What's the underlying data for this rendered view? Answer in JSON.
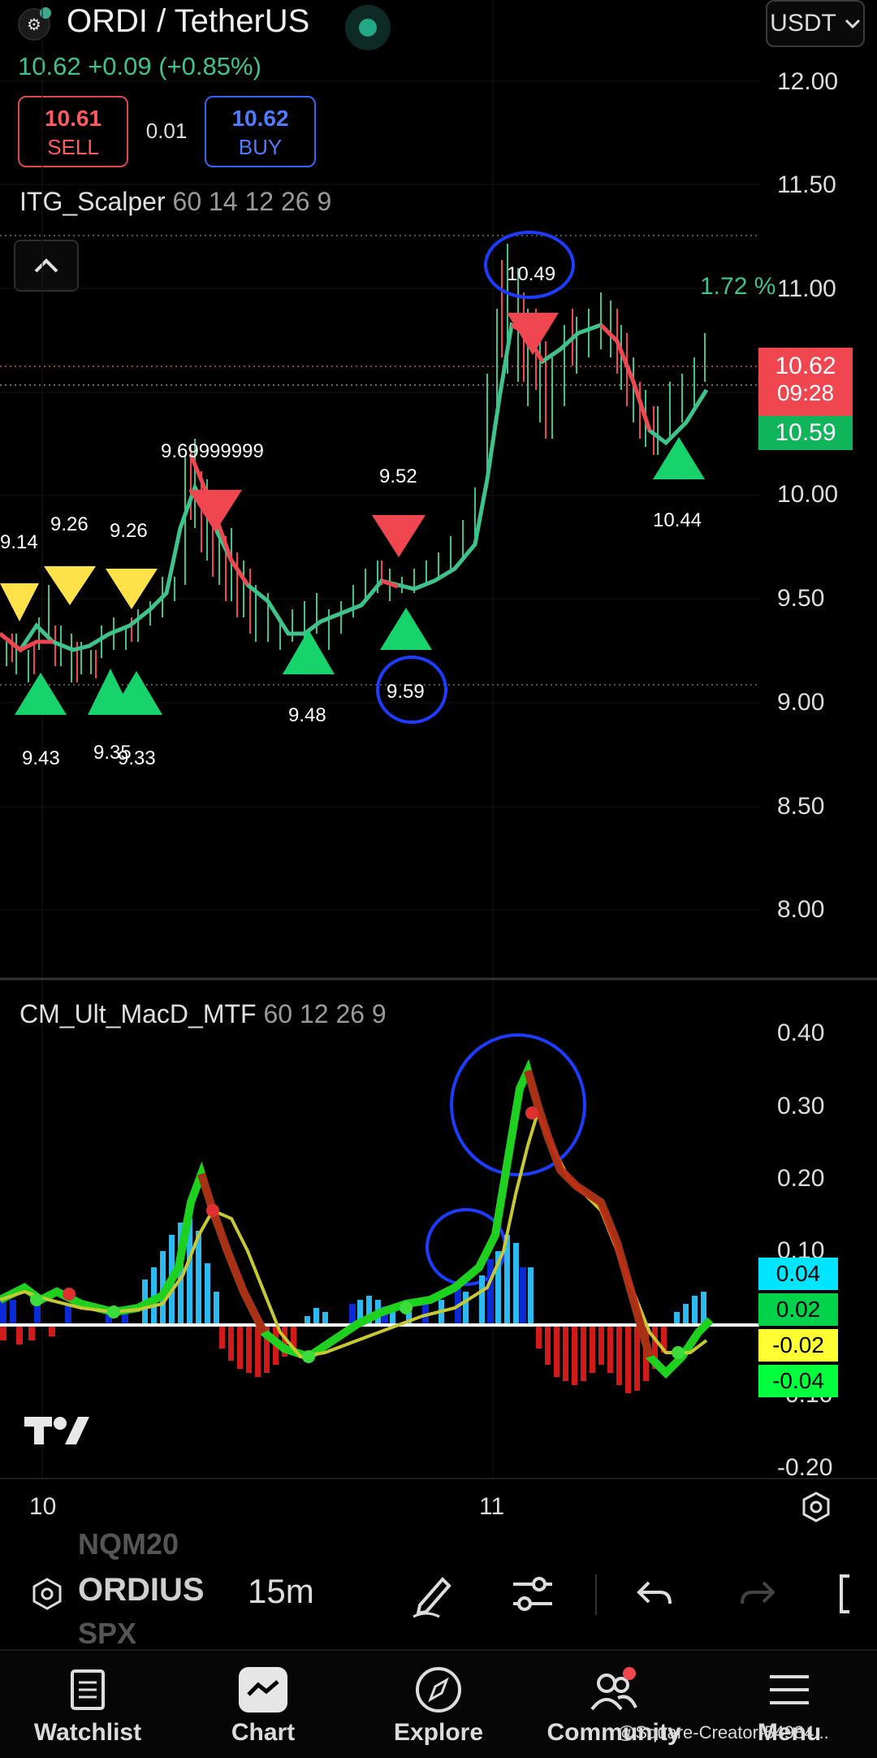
{
  "header": {
    "symbol_title": "ORDI / TetherUS",
    "quote_currency": "USDT",
    "last_change": "10.62  +0.09 (+0.85%)",
    "sell_price": "10.61",
    "sell_label": "SELL",
    "spread": "0.01",
    "buy_price": "10.62",
    "buy_label": "BUY"
  },
  "indicators": {
    "main_name": "ITG_Scalper",
    "main_params": "60 14 12 26 9",
    "macd_name": "CM_Ult_MacD_MTF",
    "macd_params": "60 12 26 9"
  },
  "price_axis": {
    "ticks": [
      "12.00",
      "11.50",
      "11.00",
      "10.50",
      "10.00",
      "9.50",
      "9.00",
      "8.50",
      "8.00"
    ],
    "current_price": "10.62",
    "countdown": "09:28",
    "green_price": "10.59"
  },
  "macd_axis": {
    "ticks": [
      "0.40",
      "0.30",
      "0.20",
      "0.10",
      "-0.10",
      "-0.20"
    ],
    "tags": [
      {
        "value": "0.04",
        "color": "#00e5ff"
      },
      {
        "value": "0.02",
        "color": "#00d24a"
      },
      {
        "value": "-0.02",
        "color": "#ffff33"
      },
      {
        "value": "-0.04",
        "color": "#00ff3c"
      }
    ]
  },
  "time_axis": {
    "ticks": [
      "10",
      "11"
    ]
  },
  "annotations": {
    "percent": "1.72 %",
    "labels": [
      "9.14",
      "9.26",
      "9.26",
      "9.69999999",
      "9.52",
      "10.49",
      "10.44",
      "9.43",
      "9.35",
      "9.33",
      "9.48",
      "9.59"
    ]
  },
  "toolbar": {
    "symbol": "ORDIUS",
    "ghost_top": "NQM20",
    "ghost_bottom": "SPX",
    "timeframe": "15m"
  },
  "nav": {
    "items": [
      "Watchlist",
      "Chart",
      "Explore",
      "Community",
      "Menu"
    ]
  },
  "watermark": "@Square-Creator-54984...",
  "colors": {
    "up": "#3ec38d",
    "down": "#f04650",
    "buy": "#4f7bff",
    "signal_yellow": "#ffe14a",
    "signal_green": "#16d36b",
    "macd_fast": "#1fd11f",
    "macd_slow": "#c8c832",
    "annotation_circle": "#1d3cff"
  }
}
